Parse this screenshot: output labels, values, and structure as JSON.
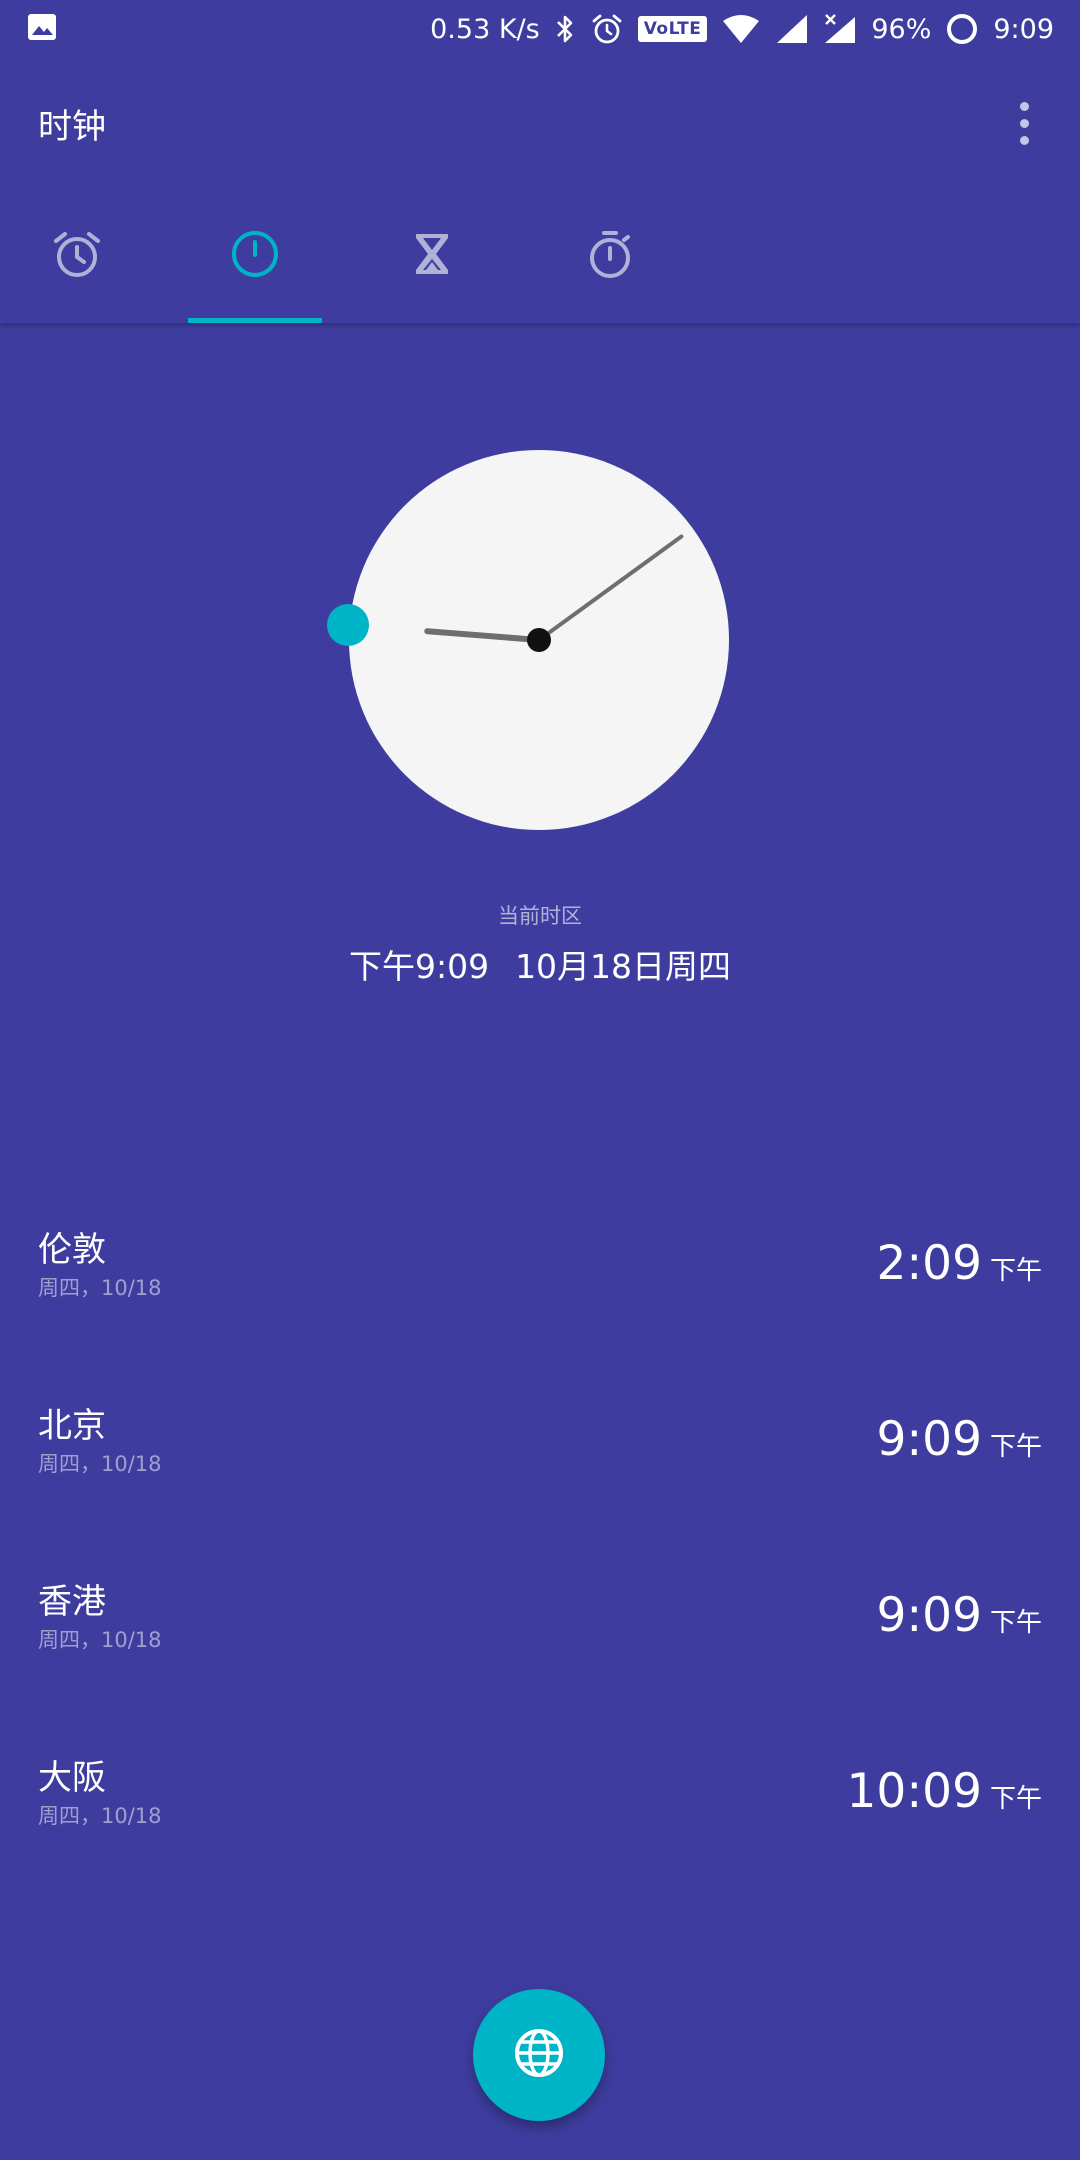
{
  "status_bar": {
    "network_speed": "0.53 K/s",
    "volte": "VoLTE",
    "battery": "96%",
    "time": "9:09"
  },
  "app_bar": {
    "title": "时钟"
  },
  "tabs": [
    {
      "icon": "alarm-icon",
      "selected": false
    },
    {
      "icon": "clock-icon",
      "selected": true
    },
    {
      "icon": "timer-hourglass-icon",
      "selected": false
    },
    {
      "icon": "stopwatch-icon",
      "selected": false
    }
  ],
  "clock": {
    "hour": 9,
    "minute": 9
  },
  "current": {
    "label": "当前时区",
    "time": "下午9:09",
    "date": "10月18日周四"
  },
  "cities": [
    {
      "name": "伦敦",
      "date": "周四，10/18",
      "time": "2:09",
      "ampm": "下午"
    },
    {
      "name": "北京",
      "date": "周四，10/18",
      "time": "9:09",
      "ampm": "下午"
    },
    {
      "name": "香港",
      "date": "周四，10/18",
      "time": "9:09",
      "ampm": "下午"
    },
    {
      "name": "大阪",
      "date": "周四，10/18",
      "time": "10:09",
      "ampm": "下午"
    }
  ],
  "fab": {
    "icon": "globe-icon"
  },
  "colors": {
    "background": "#3E3D9F",
    "accent": "#00B4C8",
    "clock_face": "#F5F5F5",
    "hand": "#6E6E6E"
  }
}
